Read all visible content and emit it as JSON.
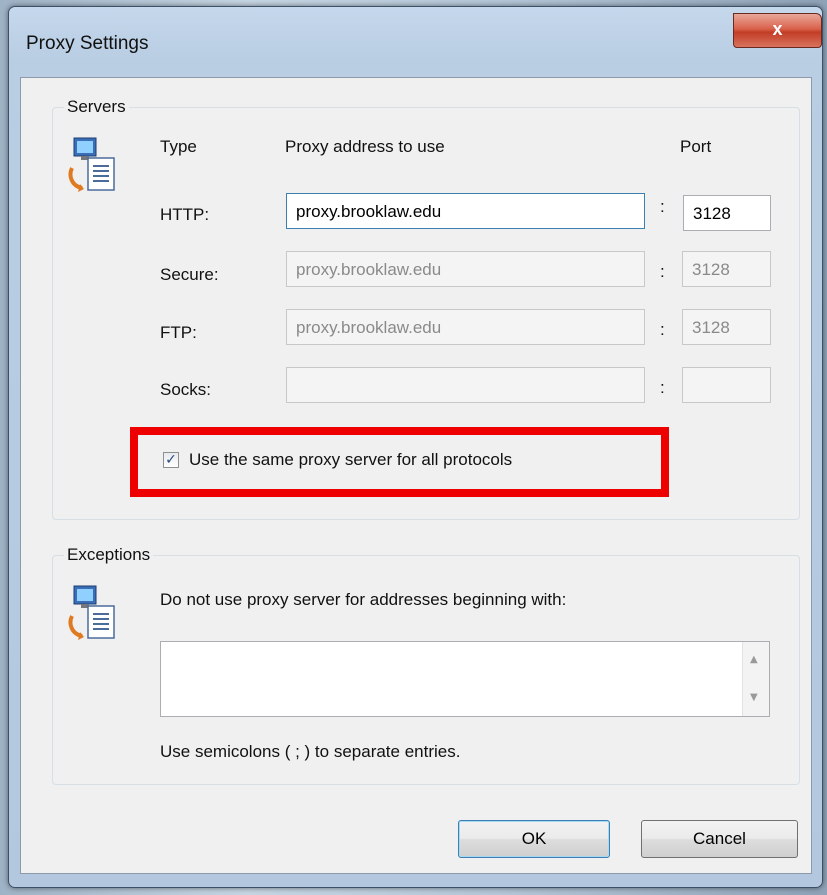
{
  "window": {
    "title": "Proxy Settings",
    "close_label": "x"
  },
  "servers": {
    "group_label": "Servers",
    "headers": {
      "type": "Type",
      "address": "Proxy address to use",
      "port": "Port"
    },
    "rows": [
      {
        "label": "HTTP:",
        "address": "proxy.brooklaw.edu",
        "port": "3128",
        "enabled": true
      },
      {
        "label": "Secure:",
        "address": "proxy.brooklaw.edu",
        "port": "3128",
        "enabled": false
      },
      {
        "label": "FTP:",
        "address": "proxy.brooklaw.edu",
        "port": "3128",
        "enabled": false
      },
      {
        "label": "Socks:",
        "address": "",
        "port": "",
        "enabled": false
      }
    ],
    "separator": ":",
    "same_proxy_label": "Use the same proxy server for all protocols",
    "same_proxy_checked": true
  },
  "exceptions": {
    "group_label": "Exceptions",
    "description": "Do not use proxy server for addresses beginning with:",
    "value": "",
    "hint": "Use semicolons ( ; ) to separate entries."
  },
  "buttons": {
    "ok": "OK",
    "cancel": "Cancel"
  },
  "colors": {
    "highlight": "#ee0000",
    "close_button": "#c9432b"
  },
  "icons": {
    "servers": "network-computer-icon",
    "exceptions": "network-computer-icon"
  }
}
